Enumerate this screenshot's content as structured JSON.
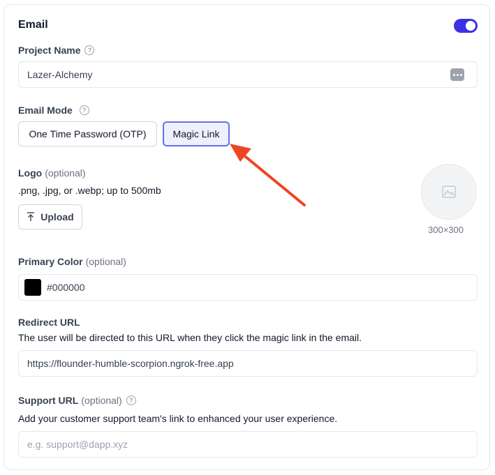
{
  "section": {
    "title": "Email",
    "toggle_on": true,
    "accent": "#3b30e6"
  },
  "project_name": {
    "label": "Project Name",
    "value": "Lazer-Alchemy"
  },
  "email_mode": {
    "label": "Email Mode",
    "options": [
      "One Time Password (OTP)",
      "Magic Link"
    ],
    "selected": "Magic Link"
  },
  "logo": {
    "label": "Logo",
    "optional": "(optional)",
    "hint": ".png, .jpg, or .webp; up to 500mb",
    "upload_label": "Upload",
    "dimensions": "300×300"
  },
  "primary_color": {
    "label": "Primary Color",
    "optional": "(optional)",
    "value": "#000000"
  },
  "redirect_url": {
    "label": "Redirect URL",
    "description": "The user will be directed to this URL when they click the magic link in the email.",
    "value": "https://flounder-humble-scorpion.ngrok-free.app"
  },
  "support_url": {
    "label": "Support URL",
    "optional": "(optional)",
    "description": "Add your customer support team's link to enhanced your user experience.",
    "placeholder": "e.g. support@dapp.xyz"
  },
  "annotation": {
    "arrow_color": "#ef4423"
  }
}
